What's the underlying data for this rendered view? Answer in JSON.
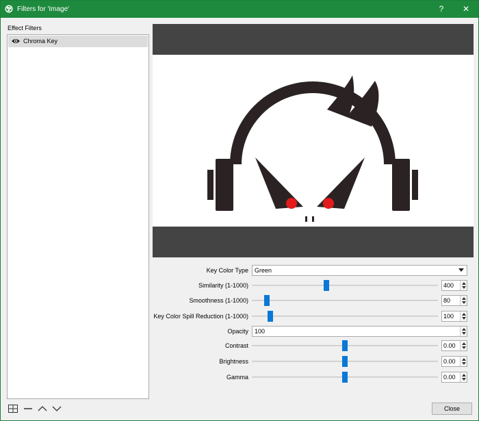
{
  "window": {
    "title": "Filters for 'Image'",
    "help": "?",
    "close": "✕"
  },
  "sidebar": {
    "heading": "Effect Filters",
    "filters": [
      {
        "label": "Chroma Key",
        "visible": true
      }
    ]
  },
  "controls": {
    "key_color_type": {
      "label": "Key Color Type",
      "value": "Green"
    },
    "similarity": {
      "label": "Similarity (1-1000)",
      "value": "400",
      "fraction": 0.4
    },
    "smoothness": {
      "label": "Smoothness (1-1000)",
      "value": "80",
      "fraction": 0.08
    },
    "spill": {
      "label": "Key Color Spill Reduction (1-1000)",
      "value": "100",
      "fraction": 0.1
    },
    "opacity": {
      "label": "Opacity",
      "value": "100"
    },
    "contrast": {
      "label": "Contrast",
      "value": "0.00",
      "fraction": 0.5
    },
    "brightness": {
      "label": "Brightness",
      "value": "0.00",
      "fraction": 0.5
    },
    "gamma": {
      "label": "Gamma",
      "value": "0.00",
      "fraction": 0.5
    }
  },
  "footer": {
    "close_label": "Close"
  },
  "colors": {
    "titlebar": "#1e8a3e",
    "slider_thumb": "#0a78d7",
    "eye_red": "#e31b1b"
  }
}
